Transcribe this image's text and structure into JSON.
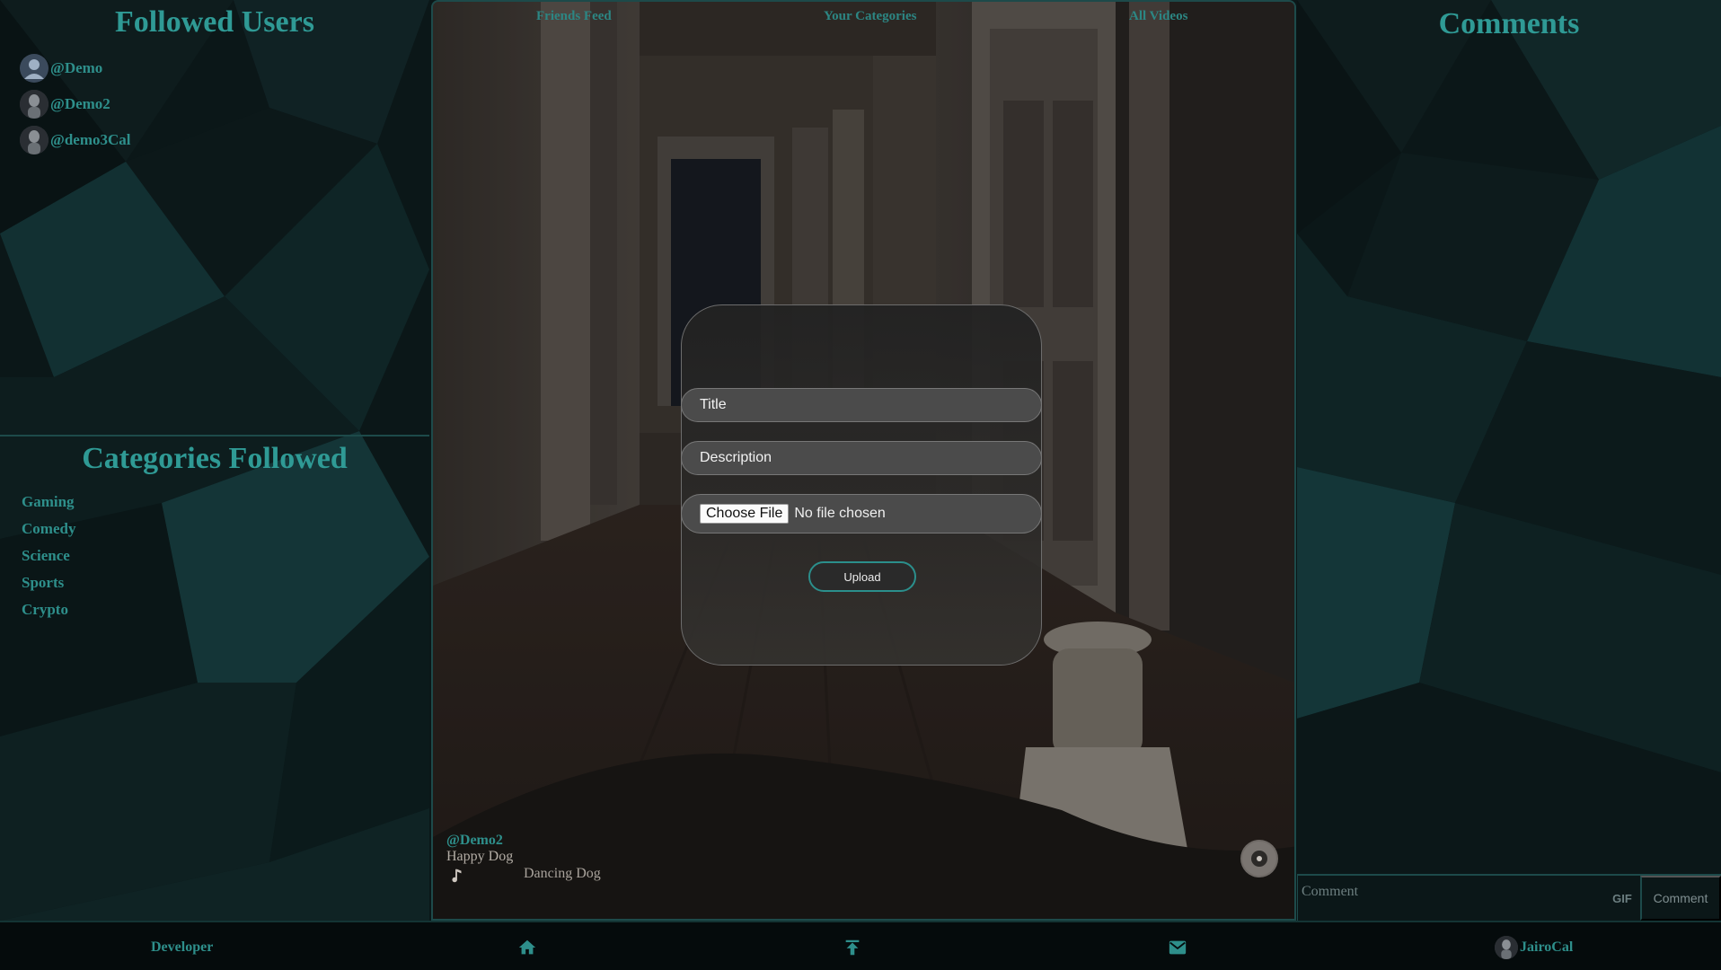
{
  "sidebar": {
    "followed_title": "Followed Users",
    "users": [
      {
        "handle": "@Demo",
        "avatar_icon": "default-user-icon"
      },
      {
        "handle": "@Demo2",
        "avatar_icon": "user-photo-icon"
      },
      {
        "handle": "@demo3Cal",
        "avatar_icon": "user-photo-icon"
      }
    ],
    "categories_title": "Categories Followed",
    "categories": [
      "Gaming",
      "Comedy",
      "Science",
      "Sports",
      "Crypto"
    ]
  },
  "video": {
    "tabs": [
      {
        "label": "Friends Feed"
      },
      {
        "label": "Your Categories"
      },
      {
        "label": "All Videos"
      }
    ],
    "author": "@Demo2",
    "title": "Happy Dog",
    "song": "Dancing Dog",
    "music_icon": "music-note-icon",
    "disc_icon": "vinyl-disc-icon"
  },
  "upload_modal": {
    "title_placeholder": "Title",
    "description_placeholder": "Description",
    "choose_file_label": "Choose File",
    "file_status": "No file chosen",
    "upload_label": "Upload"
  },
  "comments": {
    "title": "Comments",
    "input_placeholder": "Comment",
    "gif_label": "GIF",
    "submit_label": "Comment"
  },
  "bottom_nav": {
    "developer_label": "Developer",
    "home_icon": "home-icon",
    "upload_icon": "upload-icon",
    "mail_icon": "mail-icon",
    "username": "JairoCal"
  },
  "colors": {
    "accent": "#2e8f8b",
    "background": "#0a1516",
    "border": "#1d4a4a"
  }
}
